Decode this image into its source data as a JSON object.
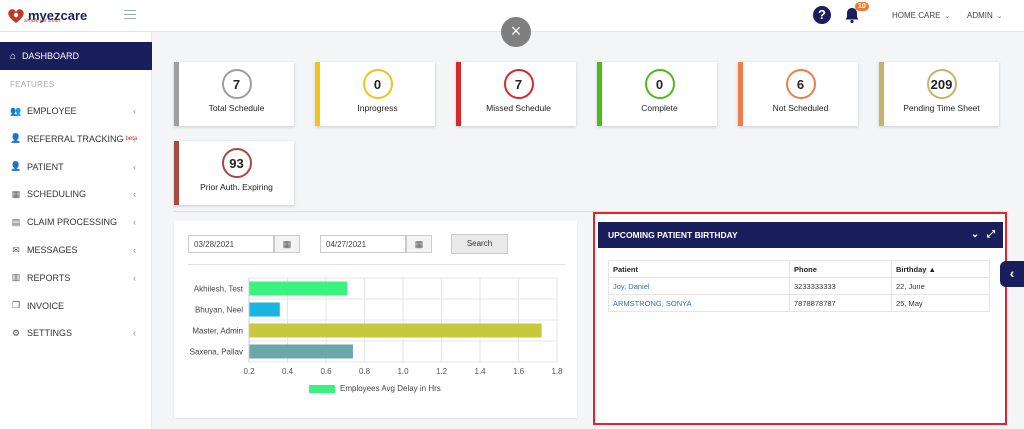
{
  "app": {
    "brand": "myezcare",
    "tagline": "simple yet smart",
    "notification_count": "10",
    "nav_home_care": "HOME CARE",
    "nav_admin": "ADMIN",
    "brand_color": "#1a1f5c"
  },
  "sidebar": {
    "active": "DASHBOARD",
    "section": "FEATURES",
    "items": [
      {
        "label": "EMPLOYEE",
        "icon": "users-icon",
        "glyph": "👥",
        "chevron": true
      },
      {
        "label": "REFERRAL TRACKING",
        "icon": "user-icon",
        "glyph": "👤",
        "badge": "beta",
        "chevron": true
      },
      {
        "label": "PATIENT",
        "icon": "user-icon",
        "glyph": "👤",
        "chevron": true
      },
      {
        "label": "SCHEDULING",
        "icon": "calendar-icon",
        "glyph": "▦",
        "chevron": true
      },
      {
        "label": "CLAIM PROCESSING",
        "icon": "file-icon",
        "glyph": "▤",
        "chevron": true
      },
      {
        "label": "MESSAGES",
        "icon": "envelope-icon",
        "glyph": "✉",
        "chevron": true
      },
      {
        "label": "REPORTS",
        "icon": "bar-chart-icon",
        "glyph": "▥",
        "chevron": true
      },
      {
        "label": "INVOICE",
        "icon": "copy-icon",
        "glyph": "❐",
        "chevron": false
      },
      {
        "label": "SETTINGS",
        "icon": "gear-icon",
        "glyph": "⚙",
        "chevron": true
      }
    ]
  },
  "stats": [
    {
      "value": "7",
      "label": "Total Schedule",
      "color": "#9e9e9e"
    },
    {
      "value": "0",
      "label": "Inprogress",
      "color": "#f0c419"
    },
    {
      "value": "7",
      "label": "Missed Schedule",
      "color": "#d62828"
    },
    {
      "value": "0",
      "label": "Complete",
      "color": "#4cbb17"
    },
    {
      "value": "6",
      "label": "Not Scheduled",
      "color": "#f07c4a"
    },
    {
      "value": "209",
      "label": "Pending Time Sheet",
      "color": "#c9b26b"
    },
    {
      "value": "93",
      "label": "Prior Auth. Expiring",
      "color": "#a84a3f"
    }
  ],
  "filters": {
    "start_date": "03/28/2021",
    "end_date": "04/27/2021",
    "search_label": "Search"
  },
  "chart_data": {
    "type": "bar",
    "orientation": "horizontal",
    "categories": [
      "Akhilesh, Test",
      "Bhuyan, Neel",
      "Master, Admin",
      "Saxena, Pallav"
    ],
    "series": [
      {
        "name": "Employees Avg Delay in Hrs",
        "values": [
          0.71,
          0.36,
          1.72,
          0.74
        ]
      }
    ],
    "bar_colors": [
      "#3cf27e",
      "#1ab4e0",
      "#c8c83c",
      "#6aa7a6"
    ],
    "xlim": [
      0.2,
      1.8
    ],
    "xticks": [
      "0.2",
      "0.4",
      "0.6",
      "0.8",
      "1.0",
      "1.2",
      "1.4",
      "1.6",
      "1.8"
    ],
    "grid": true,
    "legend": "bottom"
  },
  "birthdays": {
    "title": "UPCOMING PATIENT BIRTHDAY",
    "columns": [
      "Patient",
      "Phone",
      "Birthday"
    ],
    "rows": [
      {
        "patient": "Joy, Daniel",
        "phone": "3233333333",
        "birthday": "22, June"
      },
      {
        "patient": "ARMSTRONG, SONYA",
        "phone": "7878878787",
        "birthday": "25, May"
      }
    ]
  }
}
